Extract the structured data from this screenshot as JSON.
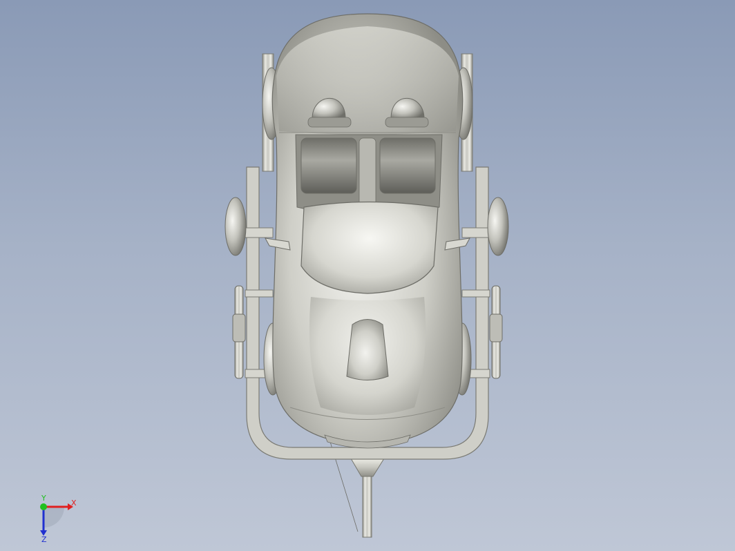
{
  "viewport": {
    "background_top": "#8a9ab6",
    "background_bottom": "#bfc7d6",
    "model": {
      "name": "car-on-trailer-top-view",
      "body_color": "#c9c9c2",
      "highlight_color": "#f4f4f0",
      "shadow_color": "#7d7d76"
    }
  },
  "triad": {
    "x_label": "X",
    "y_label": "Y",
    "z_label": "Z",
    "x_color": "#e02020",
    "y_color": "#20c020",
    "z_color": "#2030d0"
  }
}
